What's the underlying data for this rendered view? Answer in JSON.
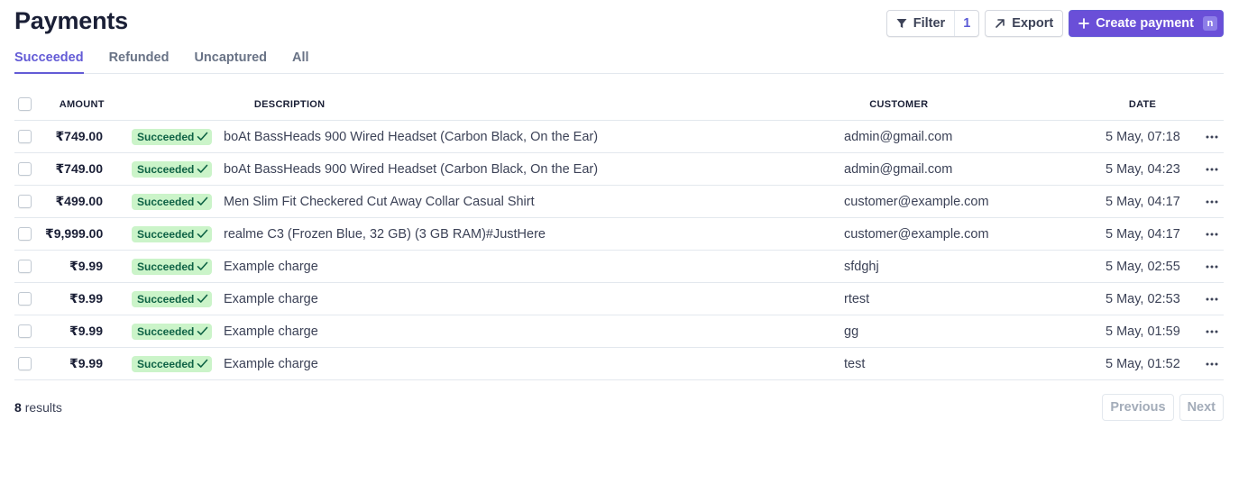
{
  "header": {
    "title": "Payments",
    "filter_label": "Filter",
    "filter_count": "1",
    "export_label": "Export",
    "create_label": "Create payment",
    "create_shortcut": "n"
  },
  "tabs": [
    {
      "label": "Succeeded",
      "active": true
    },
    {
      "label": "Refunded",
      "active": false
    },
    {
      "label": "Uncaptured",
      "active": false
    },
    {
      "label": "All",
      "active": false
    }
  ],
  "table": {
    "columns": {
      "amount": "AMOUNT",
      "description": "DESCRIPTION",
      "customer": "CUSTOMER",
      "date": "DATE"
    },
    "rows": [
      {
        "amount": "₹749.00",
        "status": "Succeeded",
        "description": "boAt BassHeads 900 Wired Headset (Carbon Black, On the Ear)",
        "customer": "admin@gmail.com",
        "date": "5 May, 07:18"
      },
      {
        "amount": "₹749.00",
        "status": "Succeeded",
        "description": "boAt BassHeads 900 Wired Headset (Carbon Black, On the Ear)",
        "customer": "admin@gmail.com",
        "date": "5 May, 04:23"
      },
      {
        "amount": "₹499.00",
        "status": "Succeeded",
        "description": "Men Slim Fit Checkered Cut Away Collar Casual Shirt",
        "customer": "customer@example.com",
        "date": "5 May, 04:17"
      },
      {
        "amount": "₹9,999.00",
        "status": "Succeeded",
        "description": "realme C3 (Frozen Blue, 32 GB) (3 GB RAM)#JustHere",
        "customer": "customer@example.com",
        "date": "5 May, 04:17"
      },
      {
        "amount": "₹9.99",
        "status": "Succeeded",
        "description": "Example charge",
        "customer": "sfdghj",
        "date": "5 May, 02:55"
      },
      {
        "amount": "₹9.99",
        "status": "Succeeded",
        "description": "Example charge",
        "customer": "rtest",
        "date": "5 May, 02:53"
      },
      {
        "amount": "₹9.99",
        "status": "Succeeded",
        "description": "Example charge",
        "customer": "gg",
        "date": "5 May, 01:59"
      },
      {
        "amount": "₹9.99",
        "status": "Succeeded",
        "description": "Example charge",
        "customer": "test",
        "date": "5 May, 01:52"
      }
    ]
  },
  "footer": {
    "results_count": "8",
    "results_label": "results",
    "previous_label": "Previous",
    "next_label": "Next"
  },
  "icons": {
    "filter": "filter-icon",
    "export": "arrow-up-right-icon",
    "create": "plus-icon",
    "status": "checkmark-icon",
    "row_menu": "more-horizontal-icon"
  },
  "colors": {
    "accent": "#635bd6",
    "primary_button": "#6a4fd8",
    "badge_bg": "#cbf4c9",
    "badge_text": "#0e6245"
  }
}
